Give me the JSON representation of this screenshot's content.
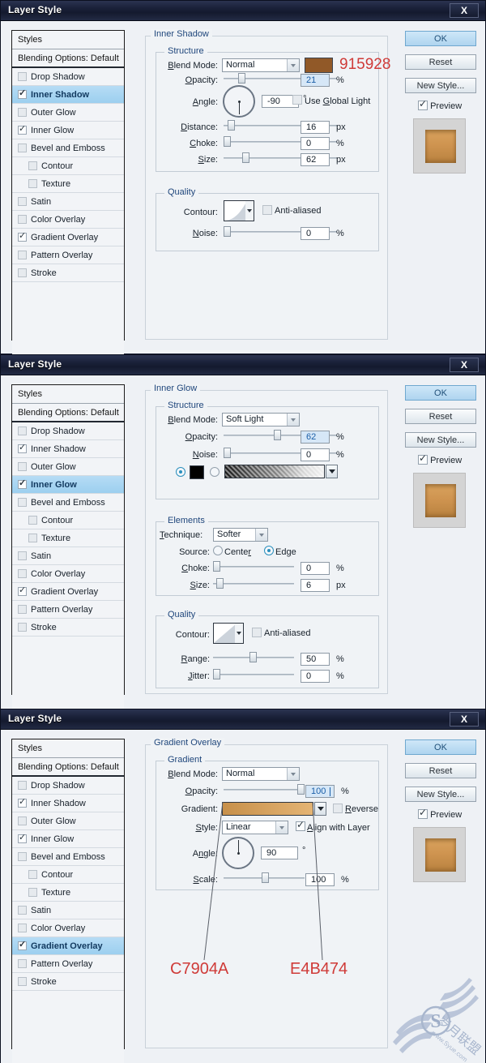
{
  "dialogs": [
    {
      "title": "Layer Style",
      "close_label": "X",
      "styles_panel": {
        "header": "Styles",
        "blending_options": "Blending Options: Default",
        "items": [
          {
            "label": "Drop Shadow",
            "checked": false,
            "selected": false,
            "indent": false
          },
          {
            "label": "Inner Shadow",
            "checked": true,
            "selected": true,
            "indent": false
          },
          {
            "label": "Outer Glow",
            "checked": false,
            "selected": false,
            "indent": false
          },
          {
            "label": "Inner Glow",
            "checked": true,
            "selected": false,
            "indent": false
          },
          {
            "label": "Bevel and Emboss",
            "checked": false,
            "selected": false,
            "indent": false
          },
          {
            "label": "Contour",
            "checked": false,
            "selected": false,
            "indent": true
          },
          {
            "label": "Texture",
            "checked": false,
            "selected": false,
            "indent": true
          },
          {
            "label": "Satin",
            "checked": false,
            "selected": false,
            "indent": false
          },
          {
            "label": "Color Overlay",
            "checked": false,
            "selected": false,
            "indent": false
          },
          {
            "label": "Gradient Overlay",
            "checked": true,
            "selected": false,
            "indent": false
          },
          {
            "label": "Pattern Overlay",
            "checked": false,
            "selected": false,
            "indent": false
          },
          {
            "label": "Stroke",
            "checked": false,
            "selected": false,
            "indent": false
          }
        ]
      },
      "pane_title": "Inner Shadow",
      "groups": {
        "structure": {
          "label": "Structure",
          "blend_mode_label": "Blend Mode:",
          "blend_mode_value": "Normal",
          "color_hex": "#915928",
          "color_note": "915928",
          "opacity_label": "Opacity:",
          "opacity_value": "21",
          "opacity_unit": "%",
          "angle_label": "Angle:",
          "angle_value": "-90",
          "angle_unit": "°",
          "use_global_light_label": "Use Global Light",
          "use_global_light_checked": false,
          "distance_label": "Distance:",
          "distance_value": "16",
          "distance_unit": "px",
          "choke_label": "Choke:",
          "choke_value": "0",
          "choke_unit": "%",
          "size_label": "Size:",
          "size_value": "62",
          "size_unit": "px"
        },
        "quality": {
          "label": "Quality",
          "contour_label": "Contour:",
          "anti_aliased_label": "Anti-aliased",
          "anti_aliased_checked": false,
          "noise_label": "Noise:",
          "noise_value": "0",
          "noise_unit": "%"
        }
      },
      "buttons": {
        "ok": "OK",
        "reset": "Reset",
        "new_style": "New Style...",
        "preview": "Preview",
        "preview_checked": true
      }
    },
    {
      "title": "Layer Style",
      "close_label": "X",
      "styles_panel": {
        "header": "Styles",
        "blending_options": "Blending Options: Default",
        "items": [
          {
            "label": "Drop Shadow",
            "checked": false,
            "selected": false,
            "indent": false
          },
          {
            "label": "Inner Shadow",
            "checked": true,
            "selected": false,
            "indent": false
          },
          {
            "label": "Outer Glow",
            "checked": false,
            "selected": false,
            "indent": false
          },
          {
            "label": "Inner Glow",
            "checked": true,
            "selected": true,
            "indent": false
          },
          {
            "label": "Bevel and Emboss",
            "checked": false,
            "selected": false,
            "indent": false
          },
          {
            "label": "Contour",
            "checked": false,
            "selected": false,
            "indent": true
          },
          {
            "label": "Texture",
            "checked": false,
            "selected": false,
            "indent": true
          },
          {
            "label": "Satin",
            "checked": false,
            "selected": false,
            "indent": false
          },
          {
            "label": "Color Overlay",
            "checked": false,
            "selected": false,
            "indent": false
          },
          {
            "label": "Gradient Overlay",
            "checked": true,
            "selected": false,
            "indent": false
          },
          {
            "label": "Pattern Overlay",
            "checked": false,
            "selected": false,
            "indent": false
          },
          {
            "label": "Stroke",
            "checked": false,
            "selected": false,
            "indent": false
          }
        ]
      },
      "pane_title": "Inner Glow",
      "groups": {
        "structure": {
          "label": "Structure",
          "blend_mode_label": "Blend Mode:",
          "blend_mode_value": "Soft Light",
          "opacity_label": "Opacity:",
          "opacity_value": "62",
          "opacity_unit": "%",
          "noise_label": "Noise:",
          "noise_value": "0",
          "noise_unit": "%",
          "fill_color_selected": true,
          "fill_color_hex": "#000000",
          "fill_gradient_selected": false
        },
        "elements": {
          "label": "Elements",
          "technique_label": "Technique:",
          "technique_value": "Softer",
          "source_label": "Source:",
          "source_center_label": "Center",
          "source_edge_label": "Edge",
          "source_value": "Edge",
          "choke_label": "Choke:",
          "choke_value": "0",
          "choke_unit": "%",
          "size_label": "Size:",
          "size_value": "6",
          "size_unit": "px"
        },
        "quality": {
          "label": "Quality",
          "contour_label": "Contour:",
          "anti_aliased_label": "Anti-aliased",
          "anti_aliased_checked": false,
          "range_label": "Range:",
          "range_value": "50",
          "range_unit": "%",
          "jitter_label": "Jitter:",
          "jitter_value": "0",
          "jitter_unit": "%"
        }
      },
      "buttons": {
        "ok": "OK",
        "reset": "Reset",
        "new_style": "New Style...",
        "preview": "Preview",
        "preview_checked": true
      }
    },
    {
      "title": "Layer Style",
      "close_label": "X",
      "styles_panel": {
        "header": "Styles",
        "blending_options": "Blending Options: Default",
        "items": [
          {
            "label": "Drop Shadow",
            "checked": false,
            "selected": false,
            "indent": false
          },
          {
            "label": "Inner Shadow",
            "checked": true,
            "selected": false,
            "indent": false
          },
          {
            "label": "Outer Glow",
            "checked": false,
            "selected": false,
            "indent": false
          },
          {
            "label": "Inner Glow",
            "checked": true,
            "selected": false,
            "indent": false
          },
          {
            "label": "Bevel and Emboss",
            "checked": false,
            "selected": false,
            "indent": false
          },
          {
            "label": "Contour",
            "checked": false,
            "selected": false,
            "indent": true
          },
          {
            "label": "Texture",
            "checked": false,
            "selected": false,
            "indent": true
          },
          {
            "label": "Satin",
            "checked": false,
            "selected": false,
            "indent": false
          },
          {
            "label": "Color Overlay",
            "checked": false,
            "selected": false,
            "indent": false
          },
          {
            "label": "Gradient Overlay",
            "checked": true,
            "selected": true,
            "indent": false
          },
          {
            "label": "Pattern Overlay",
            "checked": false,
            "selected": false,
            "indent": false
          },
          {
            "label": "Stroke",
            "checked": false,
            "selected": false,
            "indent": false
          }
        ]
      },
      "pane_title": "Gradient Overlay",
      "groups": {
        "gradient": {
          "label": "Gradient",
          "blend_mode_label": "Blend Mode:",
          "blend_mode_value": "Normal",
          "opacity_label": "Opacity:",
          "opacity_value": "100",
          "opacity_unit": "%",
          "gradient_label": "Gradient:",
          "gradient_start_hex": "#C7904A",
          "gradient_end_hex": "#E4B474",
          "reverse_label": "Reverse",
          "reverse_checked": false,
          "style_label": "Style:",
          "style_value": "Linear",
          "align_with_layer_label": "Align with Layer",
          "align_with_layer_checked": true,
          "angle_label": "Angle:",
          "angle_value": "90",
          "angle_unit": "°",
          "scale_label": "Scale:",
          "scale_value": "100",
          "scale_unit": "%"
        }
      },
      "annotations": [
        {
          "text": "C7904A",
          "color": "#cf3b38"
        },
        {
          "text": "E4B474",
          "color": "#cf3b38"
        }
      ],
      "buttons": {
        "ok": "OK",
        "reset": "Reset",
        "new_style": "New Style...",
        "preview": "Preview",
        "preview_checked": true
      }
    }
  ],
  "watermark": {
    "letter": "S",
    "text_cn": "岁月联盟",
    "url": "www.Syue.com"
  }
}
